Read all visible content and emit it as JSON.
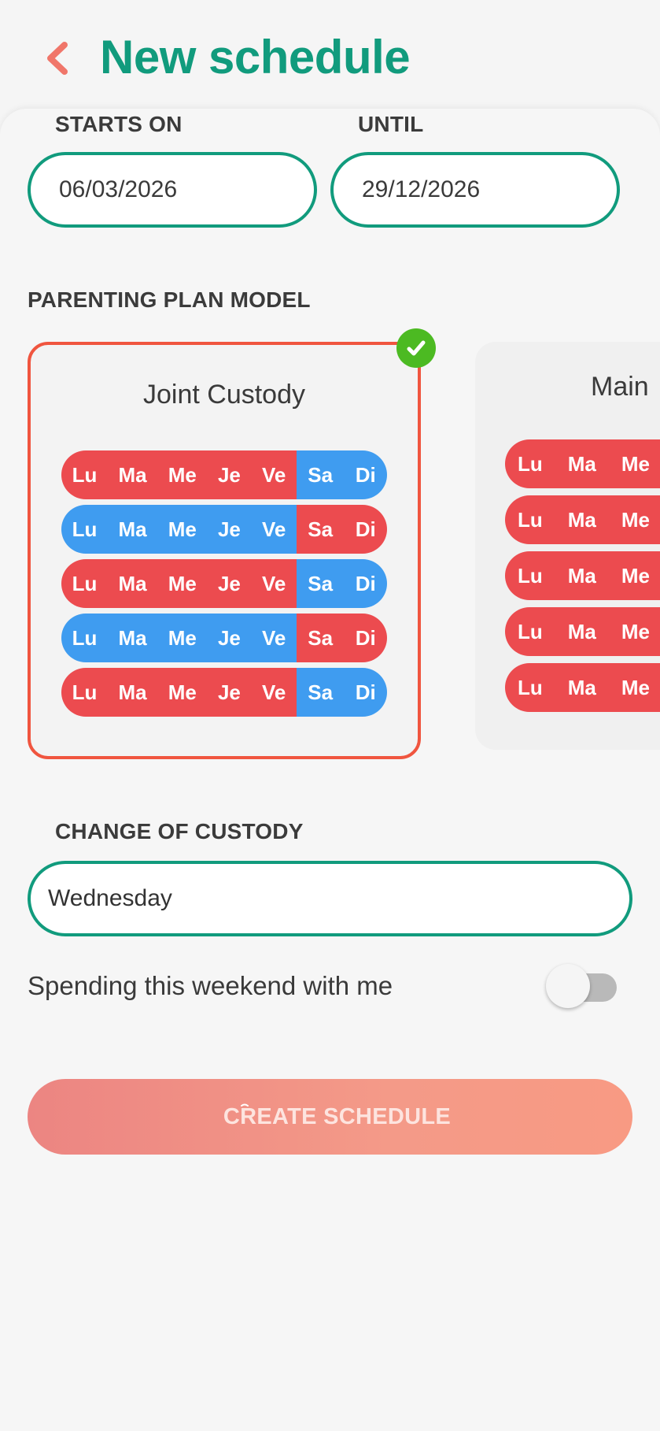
{
  "header": {
    "title": "New schedule",
    "back_icon": "chevron-left-icon",
    "accent_color": "#119b7d",
    "back_color": "#f0766a"
  },
  "dates": {
    "starts_on_label": "STARTS ON",
    "starts_on_value": "06/03/2026",
    "until_label": "UNTIL",
    "until_value": "29/12/2026"
  },
  "plan": {
    "section_label": "PARENTING PLAN MODEL",
    "cards": [
      {
        "name": "Joint Custody",
        "selected": true,
        "rows": [
          {
            "weekdays": [
              "Lu",
              "Ma",
              "Me",
              "Je",
              "Ve"
            ],
            "weekdays_color": "red",
            "weekend": [
              "Sa",
              "Di"
            ],
            "weekend_color": "blue"
          },
          {
            "weekdays": [
              "Lu",
              "Ma",
              "Me",
              "Je",
              "Ve"
            ],
            "weekdays_color": "blue",
            "weekend": [
              "Sa",
              "Di"
            ],
            "weekend_color": "red"
          },
          {
            "weekdays": [
              "Lu",
              "Ma",
              "Me",
              "Je",
              "Ve"
            ],
            "weekdays_color": "red",
            "weekend": [
              "Sa",
              "Di"
            ],
            "weekend_color": "blue"
          },
          {
            "weekdays": [
              "Lu",
              "Ma",
              "Me",
              "Je",
              "Ve"
            ],
            "weekdays_color": "blue",
            "weekend": [
              "Sa",
              "Di"
            ],
            "weekend_color": "red"
          },
          {
            "weekdays": [
              "Lu",
              "Ma",
              "Me",
              "Je",
              "Ve"
            ],
            "weekdays_color": "red",
            "weekend": [
              "Sa",
              "Di"
            ],
            "weekend_color": "blue"
          }
        ]
      },
      {
        "name": "Main",
        "selected": false,
        "rows": [
          {
            "weekdays": [
              "Lu",
              "Ma",
              "Me"
            ],
            "weekdays_color": "red"
          },
          {
            "weekdays": [
              "Lu",
              "Ma",
              "Me"
            ],
            "weekdays_color": "red"
          },
          {
            "weekdays": [
              "Lu",
              "Ma",
              "Me"
            ],
            "weekdays_color": "red"
          },
          {
            "weekdays": [
              "Lu",
              "Ma",
              "Me"
            ],
            "weekdays_color": "red"
          },
          {
            "weekdays": [
              "Lu",
              "Ma",
              "Me"
            ],
            "weekdays_color": "red"
          }
        ]
      }
    ],
    "colors": {
      "red": "#ec4b4f",
      "blue": "#3f9cf0",
      "selected_border": "#f0553f",
      "check": "#4cba22"
    },
    "check_icon": "check-circle-icon"
  },
  "custody": {
    "label": "CHANGE OF CUSTODY",
    "value": "Wednesday"
  },
  "weekend_toggle": {
    "label": "Spending this weekend with me",
    "on": false
  },
  "create_button": {
    "label": "CREATE SCHEDULE",
    "loading": true,
    "icon": "spinner-icon"
  }
}
